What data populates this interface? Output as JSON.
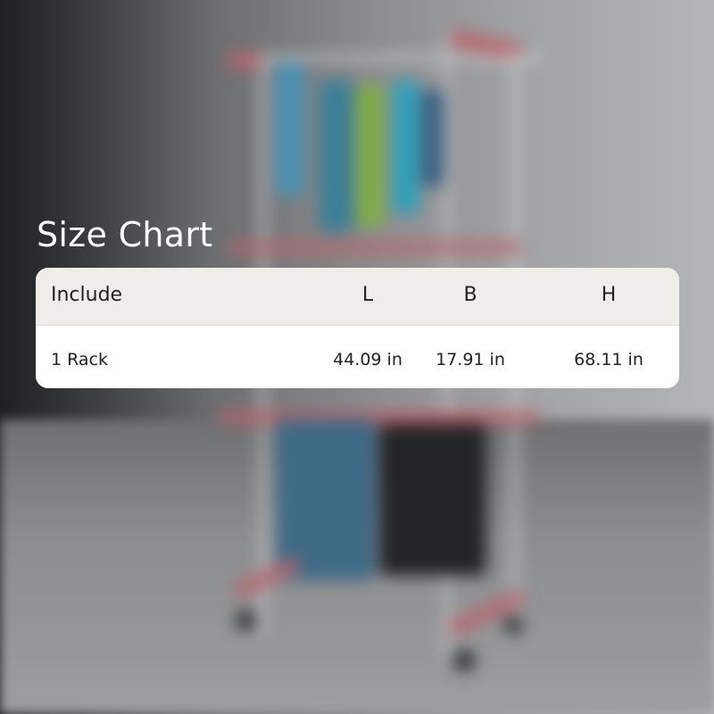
{
  "title": "Size Chart",
  "table": {
    "headers": [
      "Include",
      "L",
      "B",
      "H"
    ],
    "rows": [
      [
        "1 Rack",
        "44.09 in",
        "17.91 in",
        "68.11 in"
      ]
    ]
  },
  "colors": {
    "title_text": "#ffffff",
    "header_bg": "#efedea",
    "body_bg": "#ffffff",
    "cell_text": "#222222",
    "rack_accent": "#b8646c"
  }
}
